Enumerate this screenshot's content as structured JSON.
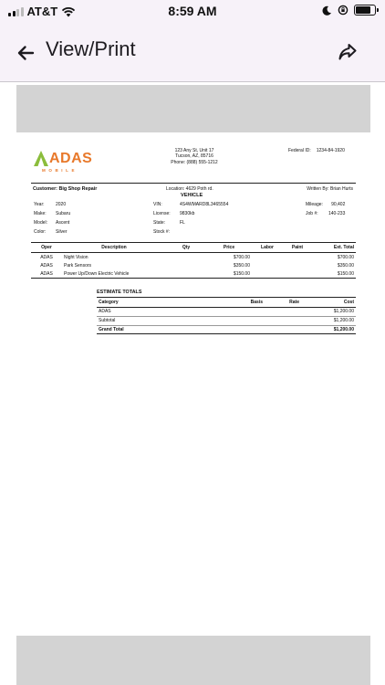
{
  "status": {
    "carrier": "AT&T",
    "time": "8:59 AM",
    "battery_level": 0.8
  },
  "appbar": {
    "title": "View/Print"
  },
  "estimate": {
    "logo": {
      "name": "ADAS",
      "sub": "MOBILE"
    },
    "shop": {
      "address1": "123 Any St, Unit 17",
      "address2": "Tucson, AZ, 85716",
      "phone": "Phone: (888) 555-1212"
    },
    "federal": {
      "label": "Federal ID:",
      "value": "1234-84-1920"
    },
    "customer": "Customer: Big Shop Repair",
    "location": "Location: 4629 Poth rd.",
    "written_by": "Written By: Brian Hurts",
    "vehicle_title": "VEHICLE",
    "vehicle_left": [
      {
        "label": "Year:",
        "value": "2020"
      },
      {
        "label": "Make:",
        "value": "Subaru"
      },
      {
        "label": "Model:",
        "value": "Ascent"
      },
      {
        "label": "Color:",
        "value": "Silver"
      }
    ],
    "vehicle_mid": [
      {
        "label": "VIN:",
        "value": "4S4WMARD8L3465554"
      },
      {
        "label": "License:",
        "value": "9830kb"
      },
      {
        "label": "State:",
        "value": "FL"
      },
      {
        "label": "Stock #:",
        "value": ""
      }
    ],
    "vehicle_right": [
      {
        "label": "Mileage:",
        "value": "90,402"
      },
      {
        "label": "Job #:",
        "value": "140-233"
      }
    ],
    "ops_headers": [
      "Oper",
      "Description",
      "Qty",
      "Price",
      "Labor",
      "Paint",
      "Ext. Total"
    ],
    "ops_rows": [
      [
        "ADAS",
        "Night Vision",
        "",
        "$700.00",
        "",
        "",
        "$700.00"
      ],
      [
        "ADAS",
        "Park Sensors",
        "",
        "$350.00",
        "",
        "",
        "$350.00"
      ],
      [
        "ADAS",
        "Power Up/Down Electric Vehicle",
        "",
        "$150.00",
        "",
        "",
        "$150.00"
      ]
    ],
    "totals_title": "ESTIMATE TOTALS",
    "totals_headers": [
      "Category",
      "Basis",
      "Rate",
      "Cost"
    ],
    "totals_rows": [
      [
        "ADAS",
        "",
        "",
        "$1,200.00"
      ],
      [
        "Subtotal",
        "",
        "",
        "$1,200.00"
      ],
      [
        "Grand Total",
        "",
        "",
        "$1,200.00"
      ]
    ]
  }
}
